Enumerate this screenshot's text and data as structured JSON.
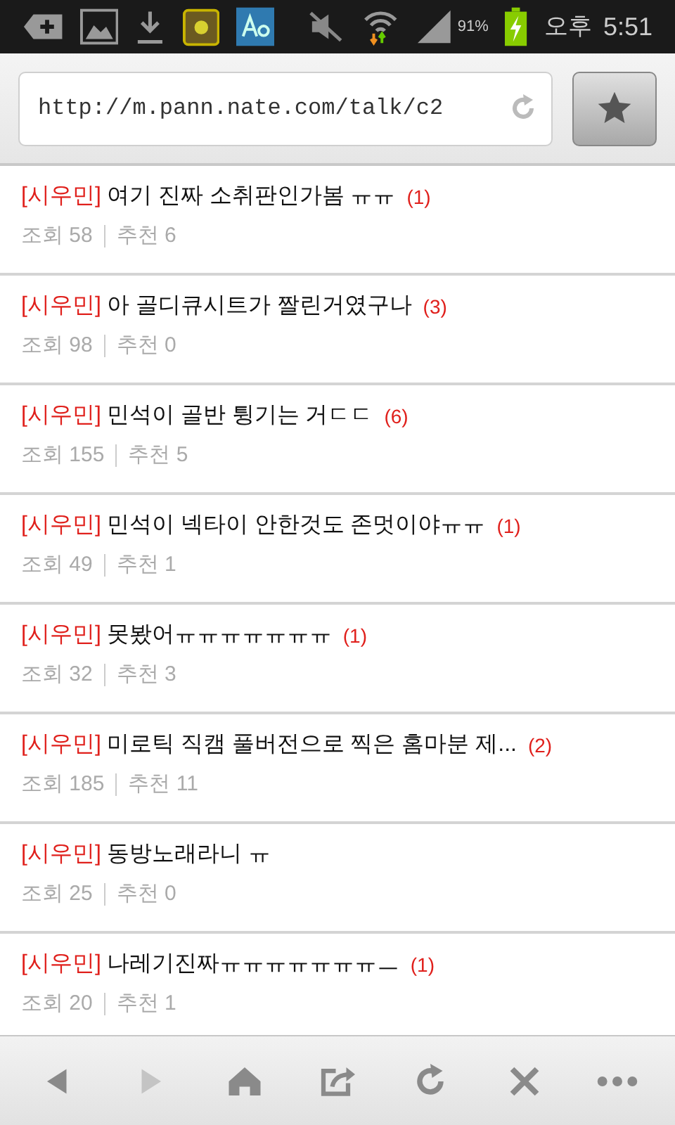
{
  "status_bar": {
    "battery": "91%",
    "ampm": "오후",
    "time": "5:51"
  },
  "address_bar": {
    "url": "http://m.pann.nate.com/talk/c2"
  },
  "posts": [
    {
      "tag": "[시우민]",
      "title": "여기 진짜 소취판인가봄 ㅠㅠ",
      "comments": "(1)",
      "views": "조회 58",
      "likes": "추천 6"
    },
    {
      "tag": "[시우민]",
      "title": "아 골디큐시트가 짤린거였구나",
      "comments": "(3)",
      "views": "조회 98",
      "likes": "추천 0"
    },
    {
      "tag": "[시우민]",
      "title": "민석이 골반 튕기는 거ㄷㄷ",
      "comments": "(6)",
      "views": "조회 155",
      "likes": "추천 5"
    },
    {
      "tag": "[시우민]",
      "title": "민석이 넥타이 안한것도 존멋이야ㅠㅠ",
      "comments": "(1)",
      "views": "조회 49",
      "likes": "추천 1"
    },
    {
      "tag": "[시우민]",
      "title": "못봤어ㅠㅠㅠㅠㅠㅠㅠ",
      "comments": "(1)",
      "views": "조회 32",
      "likes": "추천 3"
    },
    {
      "tag": "[시우민]",
      "title": "미로틱 직캠 풀버전으로 찍은 홈마분 제...",
      "comments": "(2)",
      "views": "조회 185",
      "likes": "추천 11"
    },
    {
      "tag": "[시우민]",
      "title": "동방노래라니 ㅠ",
      "views": "조회 25",
      "likes": "추천 0"
    },
    {
      "tag": "[시우민]",
      "title": "나레기진짜ㅠㅠㅠㅠㅠㅠㅠㅡ",
      "comments": "(1)",
      "views": "조회 20",
      "likes": "추천 1"
    }
  ],
  "toolbar": [
    {
      "kind": "back",
      "disabled": false
    },
    {
      "kind": "forward",
      "disabled": true
    },
    {
      "kind": "home",
      "disabled": false
    },
    {
      "kind": "share",
      "disabled": false
    },
    {
      "kind": "reload",
      "disabled": false
    },
    {
      "kind": "close",
      "disabled": false
    },
    {
      "kind": "more",
      "disabled": false
    }
  ]
}
